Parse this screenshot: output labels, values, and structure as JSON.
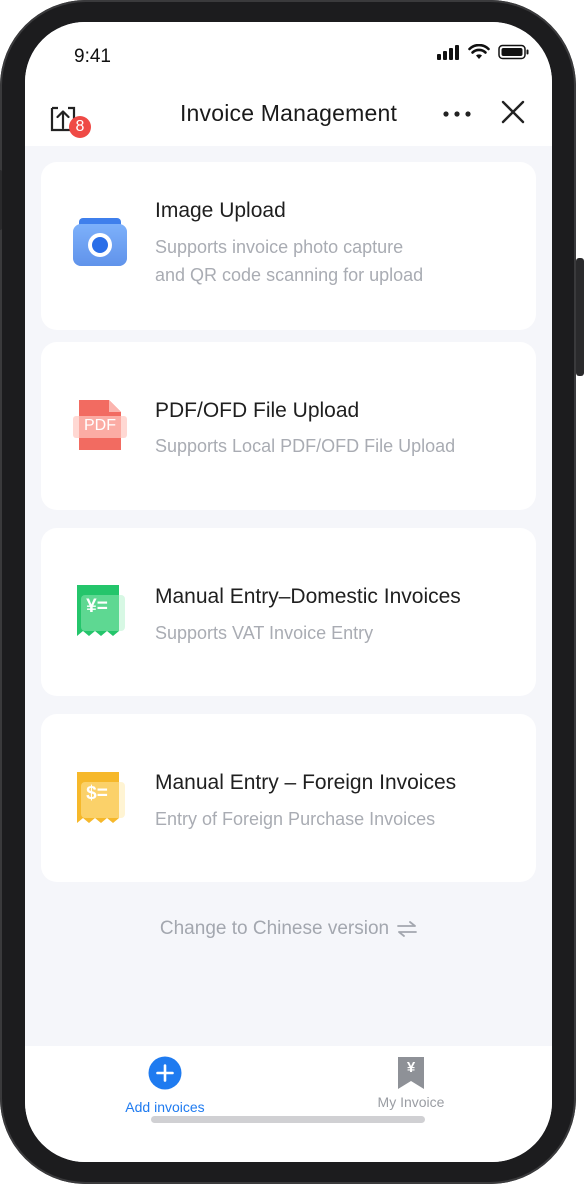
{
  "status_bar": {
    "time": "9:41"
  },
  "header": {
    "title": "Invoice Management",
    "upload_badge_count": "8"
  },
  "cards": [
    {
      "title": "Image Upload",
      "desc_line1": "Supports invoice photo capture",
      "desc_line2": "and QR code scanning for upload",
      "icon": "camera-icon"
    },
    {
      "title": "PDF/OFD File Upload",
      "desc_line1": "Supports Local PDF/OFD File Upload",
      "icon_text": "PDF",
      "icon": "pdf-file-icon"
    },
    {
      "title": "Manual Entry–Domestic Invoices",
      "desc_line1": "Supports VAT Invoice Entry",
      "icon_text": "¥=",
      "icon": "yuan-receipt-icon"
    },
    {
      "title": "Manual Entry – Foreign Invoices",
      "desc_line1": "Entry of Foreign Purchase Invoices",
      "icon_text": "$=",
      "icon": "dollar-receipt-icon"
    }
  ],
  "change_language": {
    "label": "Change to Chinese version"
  },
  "tabbar": {
    "add_label": "Add invoices",
    "my_label": "My Invoice",
    "my_icon_text": "¥"
  },
  "colors": {
    "accent": "#1f7bf0",
    "badge": "#ef4a46",
    "muted_text": "#a9acb3",
    "background": "#f5f6fa"
  }
}
